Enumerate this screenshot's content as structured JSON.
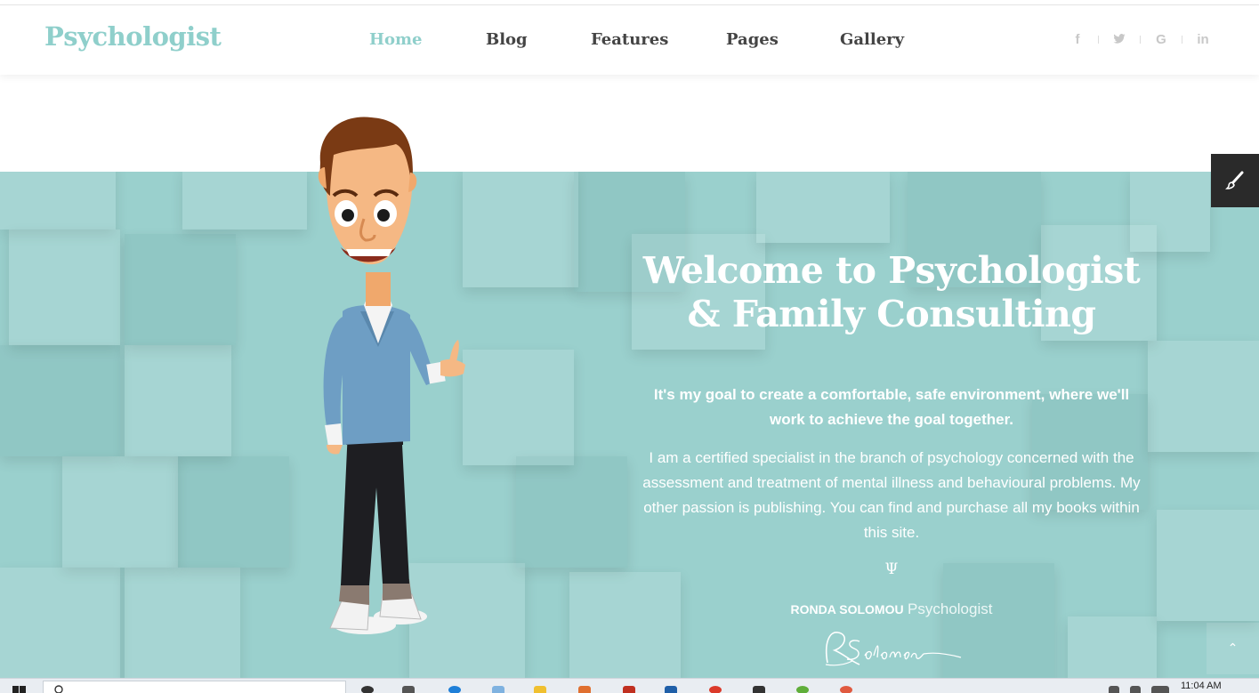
{
  "brand": {
    "logo": "Psychologist",
    "accent_color": "#8fcfcb"
  },
  "nav": [
    {
      "label": "Home",
      "active": true
    },
    {
      "label": "Blog",
      "active": false
    },
    {
      "label": "Features",
      "active": false
    },
    {
      "label": "Pages",
      "active": false
    },
    {
      "label": "Gallery",
      "active": false
    }
  ],
  "social": [
    {
      "icon": "facebook-icon",
      "glyph": "f"
    },
    {
      "icon": "twitter-icon",
      "glyph": "𝕥"
    },
    {
      "icon": "google-icon",
      "glyph": "G"
    },
    {
      "icon": "linkedin-icon",
      "glyph": "in"
    }
  ],
  "hero": {
    "title_line1": "Welcome to Psychologist",
    "title_line2": "& Family Consulting",
    "goal": "It's my goal to create a comfortable, safe environment, where we'll work to achieve the goal together.",
    "bio": "I am a certified specialist in the branch of psychology concerned with the assessment and treatment of mental illness and behavioural problems. My other passion is publishing. You can find and purchase all my books within this site.",
    "symbol": "Ψ",
    "signer_name": "RONDA SOLOMOU",
    "signer_role": "Psychologist",
    "background_color": "#9ad0cd"
  },
  "tool_button": {
    "icon": "paint-brush-icon"
  },
  "scroll_top": {
    "icon": "chevron-up-icon",
    "glyph": "⌃"
  },
  "taskbar": {
    "time": "11:04 AM"
  }
}
